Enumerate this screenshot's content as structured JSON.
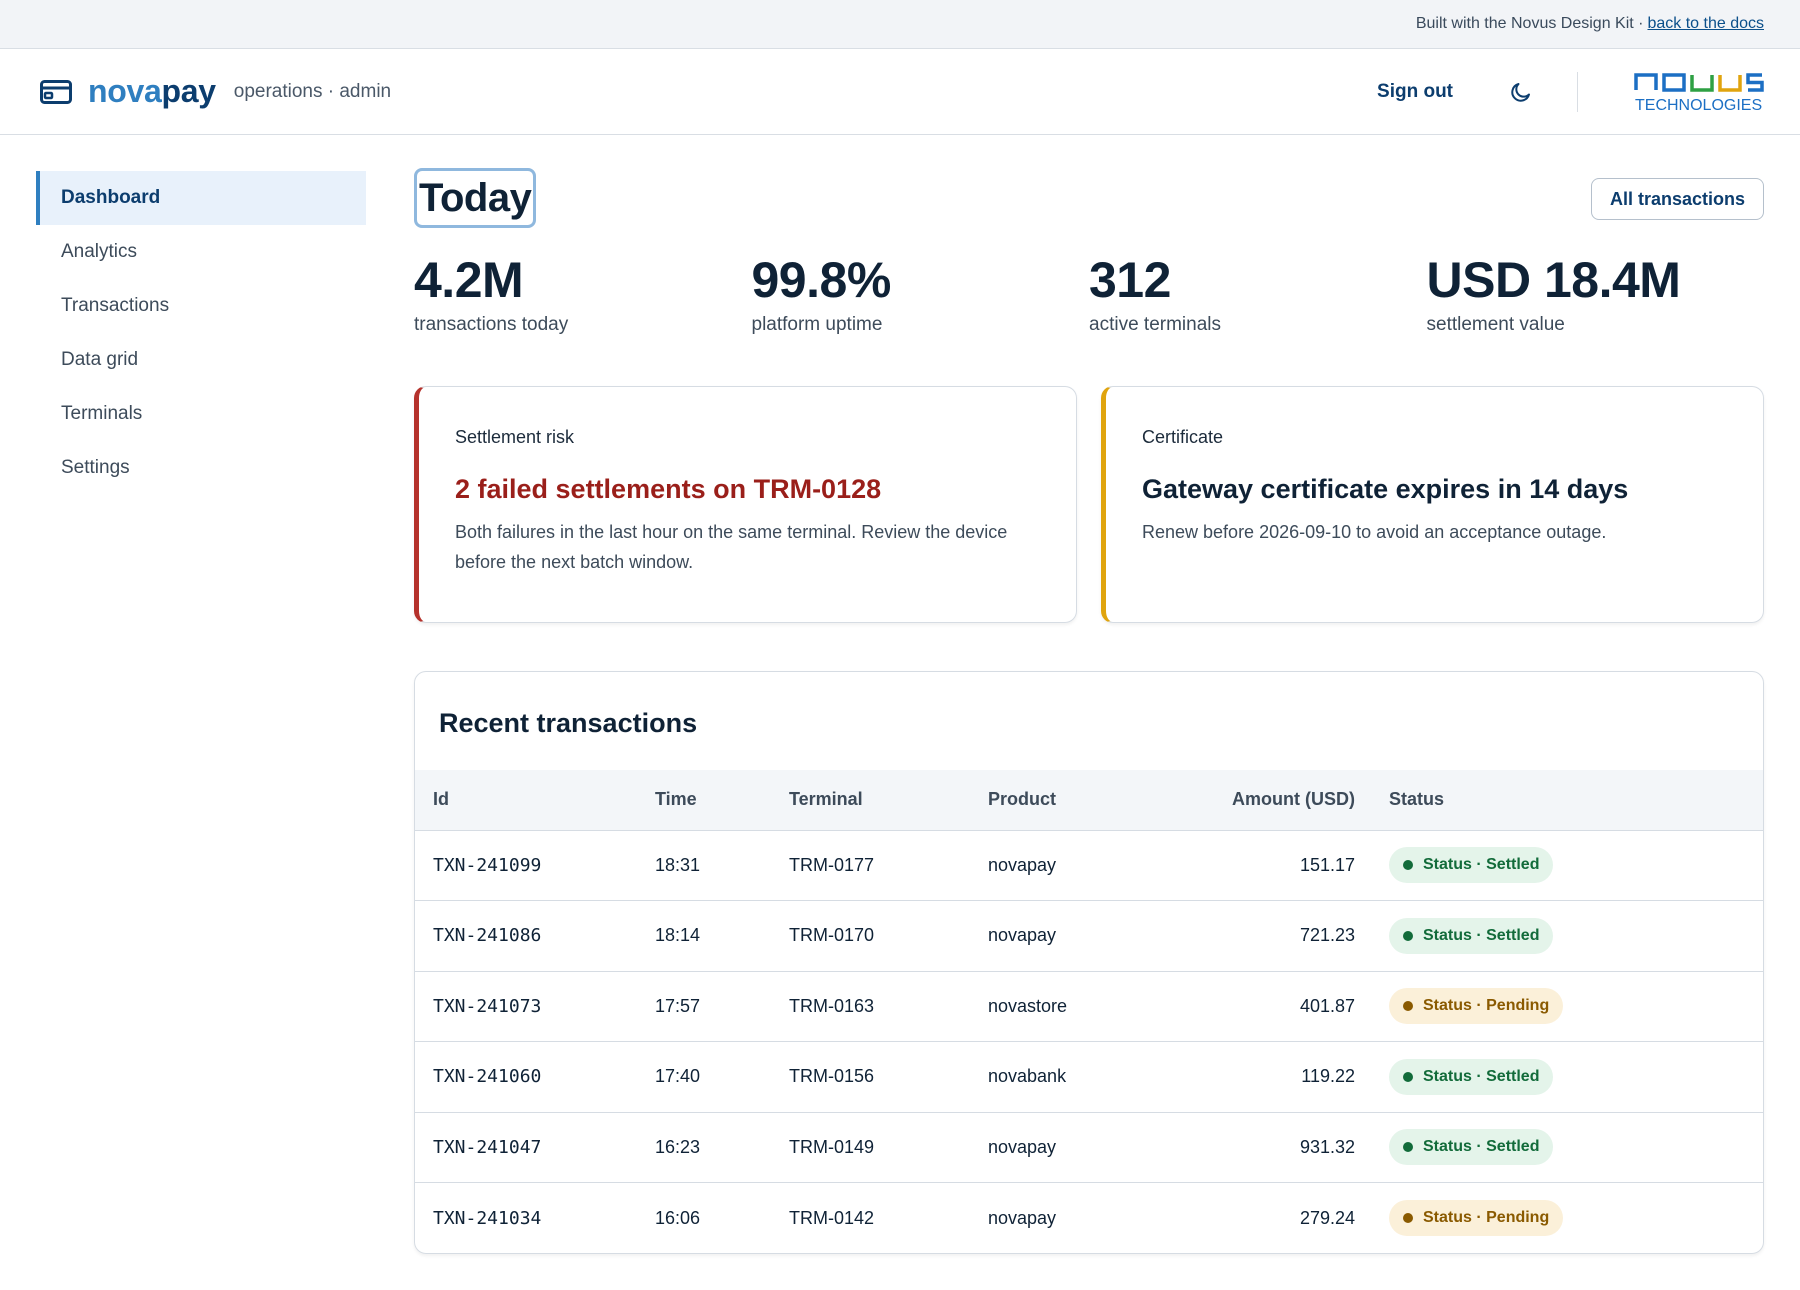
{
  "banner": {
    "text": "Built with the Novus Design Kit ·",
    "link": "back to the docs"
  },
  "header": {
    "brand_a": "nova",
    "brand_b": "pay",
    "subtitle": "operations · admin",
    "sign_out": "Sign out",
    "logo_word": "NOVUS",
    "logo_sub": "TECHNOLOGIES"
  },
  "sidebar": {
    "items": [
      {
        "label": "Dashboard",
        "active": true
      },
      {
        "label": "Analytics"
      },
      {
        "label": "Transactions"
      },
      {
        "label": "Data grid"
      },
      {
        "label": "Terminals"
      },
      {
        "label": "Settings"
      }
    ]
  },
  "main": {
    "title": "Today",
    "all_button": "All transactions",
    "stats": [
      {
        "value": "4.2M",
        "label": "transactions today"
      },
      {
        "value": "99.8%",
        "label": "platform uptime"
      },
      {
        "value": "312",
        "label": "active terminals"
      },
      {
        "value": "USD 18.4M",
        "label": "settlement value"
      }
    ],
    "alerts": [
      {
        "kicker": "Settlement risk",
        "title": "2 failed settlements on TRM-0128",
        "body": "Both failures in the last hour on the same terminal. Review the device before the next batch window."
      },
      {
        "kicker": "Certificate",
        "title": "Gateway certificate expires in 14 days",
        "body": "Renew before 2026-09-10 to avoid an acceptance outage."
      }
    ],
    "transactions": {
      "title": "Recent transactions",
      "columns": [
        "Id",
        "Time",
        "Terminal",
        "Product",
        "Amount (USD)",
        "Status"
      ],
      "rows": [
        {
          "id": "TXN-241099",
          "time": "18:31",
          "terminal": "TRM-0177",
          "product": "novapay",
          "amount": "151.17",
          "status": "Status · Settled"
        },
        {
          "id": "TXN-241086",
          "time": "18:14",
          "terminal": "TRM-0170",
          "product": "novapay",
          "amount": "721.23",
          "status": "Status · Settled"
        },
        {
          "id": "TXN-241073",
          "time": "17:57",
          "terminal": "TRM-0163",
          "product": "novastore",
          "amount": "401.87",
          "status": "Status · Pending"
        },
        {
          "id": "TXN-241060",
          "time": "17:40",
          "terminal": "TRM-0156",
          "product": "novabank",
          "amount": "119.22",
          "status": "Status · Settled"
        },
        {
          "id": "TXN-241047",
          "time": "16:23",
          "terminal": "TRM-0149",
          "product": "novapay",
          "amount": "931.32",
          "status": "Status · Settled"
        },
        {
          "id": "TXN-241034",
          "time": "16:06",
          "terminal": "TRM-0142",
          "product": "novapay",
          "amount": "279.24",
          "status": "Status · Pending"
        }
      ]
    }
  },
  "colors": {
    "accent": "#2f7fc0",
    "brand_dark": "#0c3d6e",
    "danger": "#9a1f1a",
    "warning": "#e0a40e",
    "success": "#126b3a"
  }
}
